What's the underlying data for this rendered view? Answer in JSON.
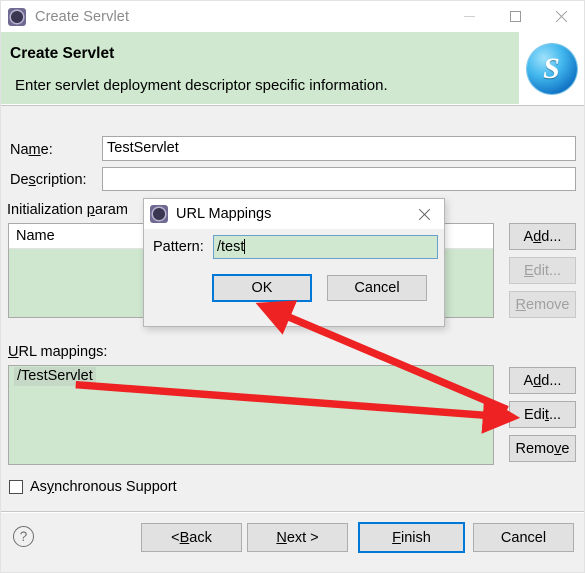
{
  "window": {
    "title": "Create Servlet",
    "icon": "eclipse-gear-icon",
    "minimize_label": "Minimize",
    "maximize_label": "Maximize",
    "close_label": "Close"
  },
  "banner": {
    "title": "Create Servlet",
    "subtitle": "Enter servlet deployment descriptor specific information.",
    "logo_letter": "S",
    "background_color": "#cfe8cf"
  },
  "form": {
    "name_label_pre": "Na",
    "name_label_accel": "m",
    "name_label_post": "e:",
    "name_value": "TestServlet",
    "description_label_pre": "De",
    "description_label_accel": "s",
    "description_label_post": "cription:",
    "description_value": ""
  },
  "init_params": {
    "label_pre": "Initialization ",
    "label_accel": "p",
    "label_post": "aram",
    "columns": [
      "Name"
    ],
    "rows": [],
    "buttons": [
      {
        "label_pre": "A",
        "accel": "d",
        "label_post": "d...",
        "enabled": true,
        "name": "init-params-add-button"
      },
      {
        "label_pre": "",
        "accel": "E",
        "label_post": "dit...",
        "enabled": false,
        "name": "init-params-edit-button"
      },
      {
        "label_pre": "",
        "accel": "R",
        "label_post": "emove",
        "enabled": false,
        "name": "init-params-remove-button"
      }
    ]
  },
  "url_mappings": {
    "label_accel": "U",
    "label_post": "RL mappings:",
    "rows": [
      "/TestServlet"
    ],
    "selected_row": "/TestServlet",
    "buttons": [
      {
        "label_pre": "A",
        "accel": "d",
        "label_post": "d...",
        "enabled": true,
        "name": "url-mappings-add-button"
      },
      {
        "label_pre": "Edi",
        "accel": "t",
        "label_post": "...",
        "enabled": true,
        "name": "url-mappings-edit-button"
      },
      {
        "label_pre": "Remo",
        "accel": "v",
        "label_post": "e",
        "enabled": true,
        "name": "url-mappings-remove-button"
      }
    ]
  },
  "async": {
    "label_pre": "As",
    "accel": "y",
    "label_post": "nchronous Support",
    "checked": false
  },
  "footer": {
    "help_glyph": "?",
    "back_pre": "< ",
    "back_accel": "B",
    "back_post": "ack",
    "next_pre": "",
    "next_accel": "N",
    "next_post": "ext >",
    "finish_pre": "",
    "finish_accel": "F",
    "finish_post": "inish",
    "cancel_label": "Cancel",
    "default_button": "Finish"
  },
  "dialog": {
    "title": "URL Mappings",
    "icon": "eclipse-gear-icon",
    "close_label": "Close",
    "pattern_label": "Pattern:",
    "pattern_value": "/test",
    "ok_label": "OK",
    "cancel_label": "Cancel",
    "focused_button": "OK"
  },
  "annotations": {
    "arrow_color": "#ee2222",
    "arrow_1_desc": "arrow from Edit button up to OK button",
    "arrow_2_desc": "arrow from /TestServlet row right to Edit button"
  }
}
